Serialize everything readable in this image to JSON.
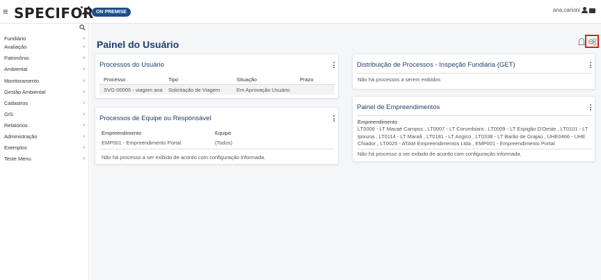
{
  "header": {
    "brand": "SPECIFOR",
    "badge": "ON PREMISE",
    "username": "ana.carioni",
    "icons": [
      "hamburger-icon",
      "user-icon",
      "mail-icon"
    ]
  },
  "sidebar": {
    "items": [
      {
        "label": "Fundiário"
      },
      {
        "label": "Avaliação"
      },
      {
        "label": "Patrimônio"
      },
      {
        "label": "Ambiental"
      },
      {
        "label": "Monitoramento"
      },
      {
        "label": "Gestão Ambiental"
      },
      {
        "label": "Cadastros"
      },
      {
        "label": "GIS"
      },
      {
        "label": "Relatórios"
      },
      {
        "label": "Administração"
      },
      {
        "label": "Exemplos"
      },
      {
        "label": "Teste Menu"
      }
    ]
  },
  "main": {
    "title": "Painel do Usuário",
    "processos_usuario": {
      "title": "Processos do Usuário",
      "columns": [
        "Processo",
        "Tipo",
        "Situação",
        "Prazo"
      ],
      "rows": [
        [
          "SVG-00005 - viagem ana",
          "Solicitação de Viagem",
          "Em Aprovação Usuário",
          ""
        ]
      ]
    },
    "processos_equipe": {
      "title": "Processos de Equipe ou Responsável",
      "columns": [
        "Empreendimento",
        "Equipe"
      ],
      "rows": [
        [
          "EMP001 - Empreendimento Portal",
          "(Todos)"
        ]
      ],
      "message": "Não há processo a ser exibido de acordo com configuração informada."
    },
    "distribuicao": {
      "title": "Distribuição de Processos - Inspeção Fundiária (GET)",
      "message": "Não há processos a serem exibidos"
    },
    "empreendimentos": {
      "title": "Painel de Empreendimentos",
      "heading": "Empreendimento",
      "list": [
        "LT0006 - LT Macaé Campos , LT0007 - LT Corumbiara , LT0009 - LT Espigão D'Oeste , LT0101 - LT",
        "Ipixuna , LT0114 - LT Maraã , LT0181 - LT Angico , LT0338 - LT Barão de Grajaú , UHE0466 - UHE",
        "Chiador , LT0025 - ATAM Empreendimentos Ltda , EMP001 - Empreendimento Portal"
      ],
      "message": "Não há processo a ser exibido de acordo com configuração informada."
    }
  },
  "colors": {
    "accent": "#1e3d6b",
    "badge": "#1b4f8a",
    "highlight": "#d31f1f"
  }
}
